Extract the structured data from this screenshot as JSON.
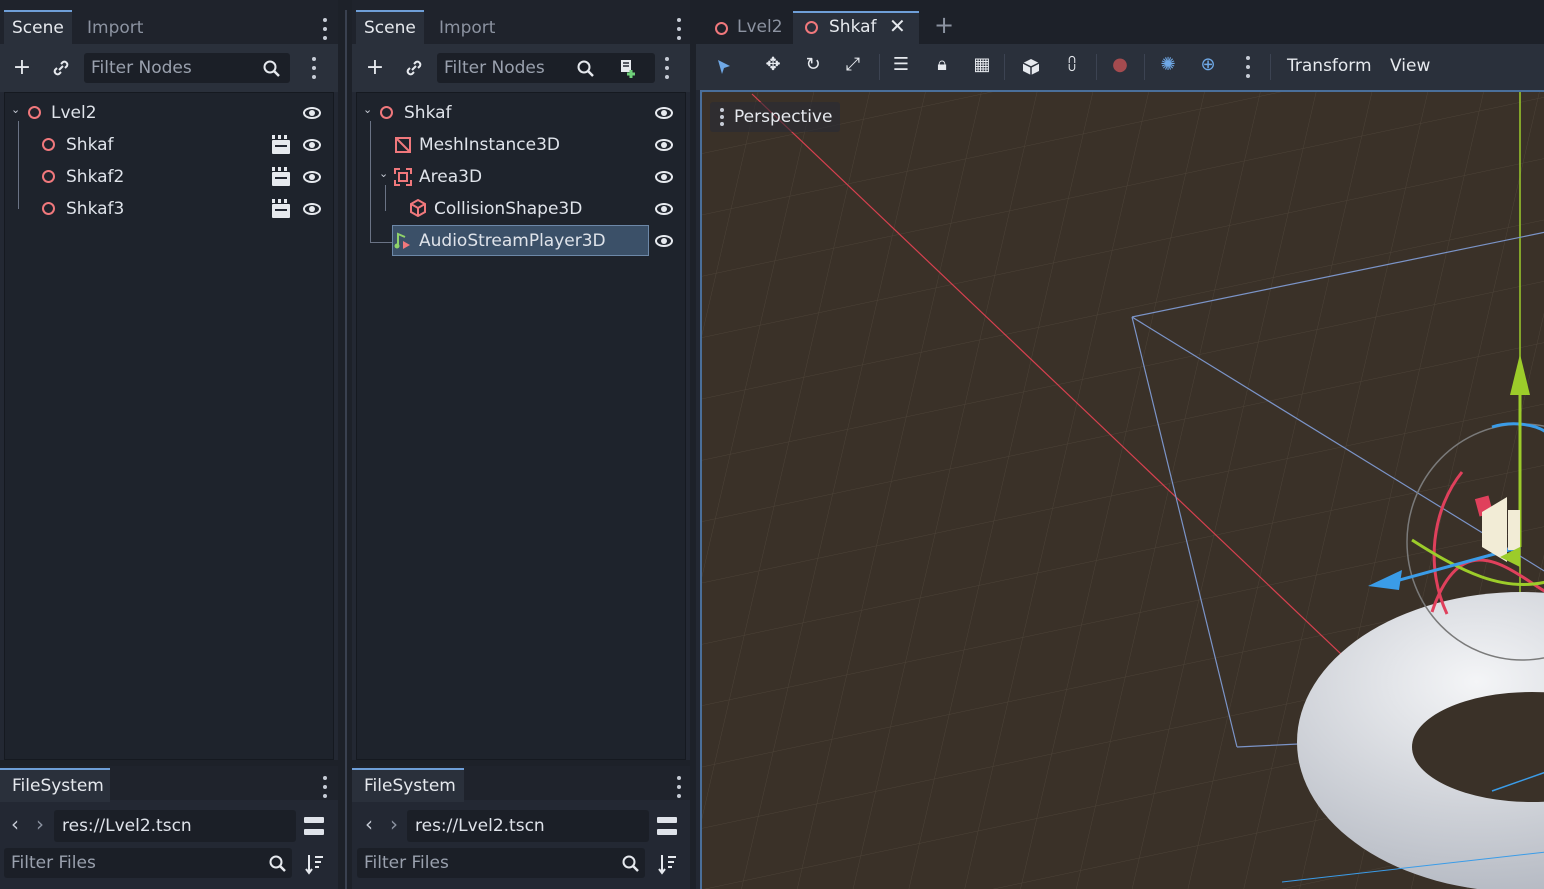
{
  "left_panel": {
    "tabs": [
      "Scene",
      "Import"
    ],
    "filter_placeholder": "Filter Nodes",
    "nodes": [
      {
        "label": "Lvel2"
      },
      {
        "label": "Shkaf"
      },
      {
        "label": "Shkaf2"
      },
      {
        "label": "Shkaf3"
      }
    ],
    "filesystem": {
      "tab": "FileSystem",
      "path": "res://Lvel2.tscn",
      "filter_placeholder": "Filter Files"
    }
  },
  "mid_panel": {
    "tabs": [
      "Scene",
      "Import"
    ],
    "filter_placeholder": "Filter Nodes",
    "nodes": [
      {
        "label": "Shkaf"
      },
      {
        "label": "MeshInstance3D"
      },
      {
        "label": "Area3D"
      },
      {
        "label": "CollisionShape3D"
      },
      {
        "label": "AudioStreamPlayer3D"
      }
    ],
    "filesystem": {
      "tab": "FileSystem",
      "path": "res://Lvel2.tscn",
      "filter_placeholder": "Filter Files"
    }
  },
  "editor": {
    "scene_tabs": [
      "Lvel2",
      "Shkaf"
    ],
    "menus": [
      "Transform",
      "View"
    ],
    "viewport_label": "Perspective"
  },
  "colors": {
    "accent": "#6f9fd8",
    "node_red": "#f0787c",
    "selection": "#3b5068",
    "viewport_bg": "#3a3128"
  }
}
